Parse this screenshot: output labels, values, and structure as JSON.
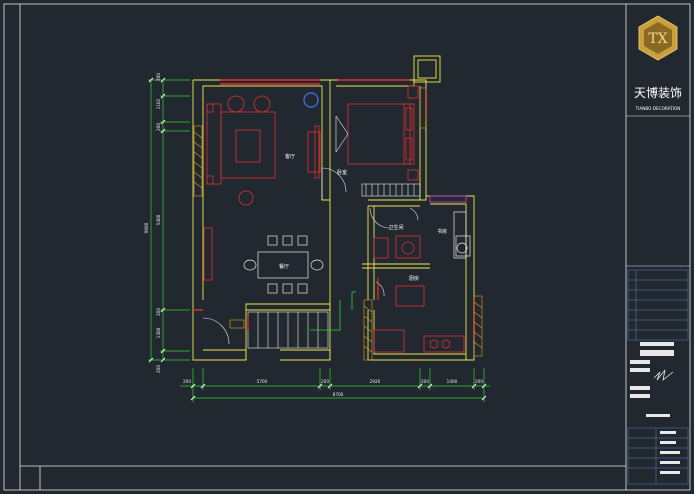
{
  "drawing": {
    "rooms": {
      "living_room": "客厅",
      "dining_room": "餐厅",
      "bedroom": "卧室",
      "study": "书房",
      "bathroom": "卫生间",
      "kitchen": "厨房"
    },
    "dimensions": {
      "bottom_segments": [
        "200",
        "5700",
        "200",
        "2920",
        "200",
        "1400",
        "200"
      ],
      "bottom_total": "8700",
      "left_segments": [
        "200",
        "1102",
        "200",
        "5400",
        "200",
        "1300",
        "200"
      ],
      "left_total": "9600"
    }
  },
  "title_block": {
    "company_name": "天博装饰",
    "company_name_en": "TIANBO DECORATION"
  }
}
